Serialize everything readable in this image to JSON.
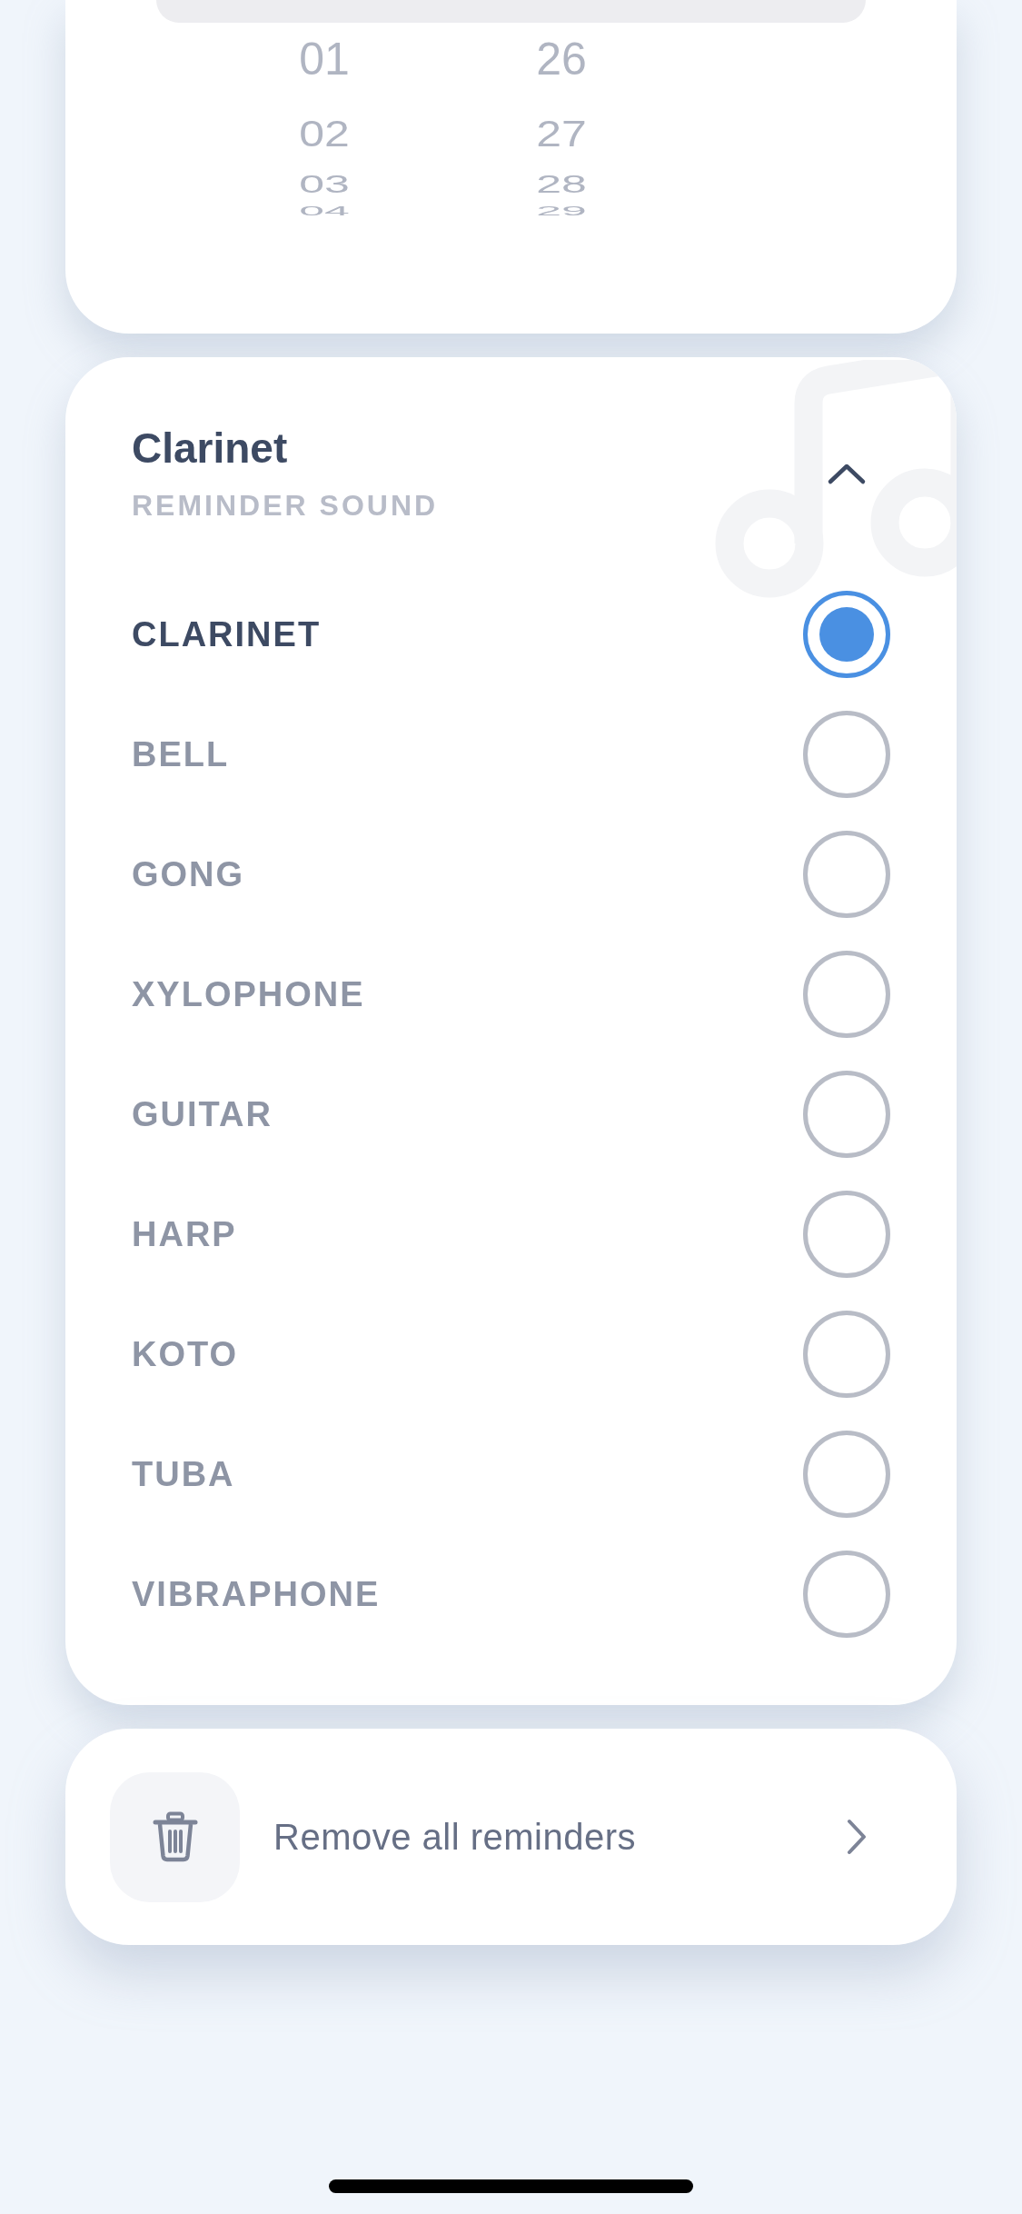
{
  "time_picker": {
    "columns": [
      {
        "items": [
          "01",
          "02",
          "03",
          "04"
        ]
      },
      {
        "items": [
          "26",
          "27",
          "28",
          "29"
        ]
      }
    ]
  },
  "sound_picker": {
    "title": "Clarinet",
    "subtitle": "REMINDER SOUND",
    "expanded": true,
    "options": [
      {
        "label": "CLARINET",
        "selected": true
      },
      {
        "label": "BELL",
        "selected": false
      },
      {
        "label": "GONG",
        "selected": false
      },
      {
        "label": "XYLOPHONE",
        "selected": false
      },
      {
        "label": "GUITAR",
        "selected": false
      },
      {
        "label": "HARP",
        "selected": false
      },
      {
        "label": "KOTO",
        "selected": false
      },
      {
        "label": "TUBA",
        "selected": false
      },
      {
        "label": "VIBRAPHONE",
        "selected": false
      }
    ]
  },
  "remove_action": {
    "label": "Remove all reminders"
  }
}
